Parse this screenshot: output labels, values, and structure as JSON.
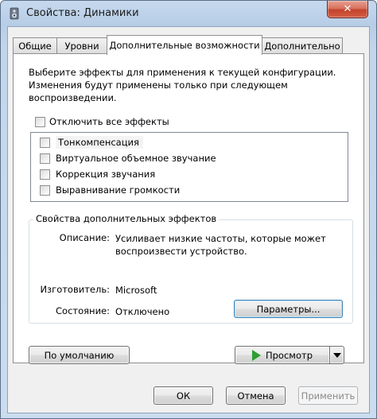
{
  "window": {
    "title": "Свойства: Динамики",
    "close_glyph": "✕"
  },
  "tabs": [
    {
      "label": "Общие"
    },
    {
      "label": "Уровни"
    },
    {
      "label": "Дополнительные возможности",
      "active": true
    },
    {
      "label": "Дополнительно"
    }
  ],
  "panel": {
    "description_lines": [
      "Выберите эффекты для применения к текущей конфигурации.",
      "Изменения будут применены только при следующем",
      "воспроизведении."
    ],
    "disable_all_label": "Отключить все эффекты",
    "disable_all_checked": false,
    "effects": [
      {
        "label": "Тонкомпенсация",
        "checked": false
      },
      {
        "label": "Виртуальное объемное звучание",
        "checked": false
      },
      {
        "label": "Коррекция звучания",
        "checked": false
      },
      {
        "label": "Выравнивание громкости",
        "checked": false
      }
    ],
    "group": {
      "title": "Свойства дополнительных эффектов",
      "description_label": "Описание:",
      "description_value_lines": [
        "Усиливает низкие частоты, которые может",
        "воспроизвести устройство."
      ],
      "provider_label": "Изготовитель:",
      "provider_value": "Microsoft",
      "state_label": "Состояние:",
      "state_value": "Отключено",
      "settings_button": "Параметры..."
    },
    "default_button": "По умолчанию",
    "preview_button": "Просмотр"
  },
  "footer": {
    "ok_label": "ОК",
    "cancel_label": "Отмена",
    "apply_label": "Применить"
  },
  "icons": {
    "title": "speaker-icon",
    "preview": "play-icon",
    "preview_menu": "chevron-down-icon"
  },
  "colors": {
    "close_button": "#c3432c",
    "play_icon": "#2f9e2f",
    "focus_border": "#3c7fb1"
  }
}
